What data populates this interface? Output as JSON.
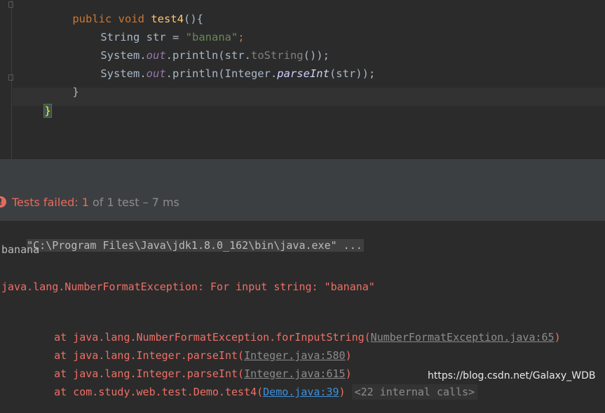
{
  "editor": {
    "line1": {
      "kw": "public void",
      "name": "test4",
      "rest": "(){"
    },
    "line2": {
      "type": "String str = ",
      "literal": "\"banana\"",
      "semi": ";"
    },
    "line3": {
      "a": "System.",
      "field": "out",
      "b": ".println(str.",
      "method": "toString",
      "c": "());"
    },
    "line4": {
      "a": "System.",
      "field": "out",
      "b": ".println(Integer.",
      "method": "parseInt",
      "c": "(str));"
    },
    "line5": "}",
    "line6": "}"
  },
  "status": {
    "icon": "error-icon",
    "failed_label": "Tests failed: 1",
    "summary": " of 1 test – 7 ms"
  },
  "console": {
    "command": "\"C:\\Program Files\\Java\\jdk1.8.0_162\\bin\\java.exe\" ...",
    "stdout": "banana",
    "exception": "java.lang.NumberFormatException: For input string: \"banana\"",
    "frames": [
      {
        "prefix": "at java.lang.NumberFormatException.forInputString(",
        "link": "NumberFormatException.java:65",
        "suffix": ")"
      },
      {
        "prefix": "at java.lang.Integer.parseInt(",
        "link": "Integer.java:580",
        "suffix": ")"
      },
      {
        "prefix": "at java.lang.Integer.parseInt(",
        "link": "Integer.java:615",
        "suffix": ")"
      },
      {
        "prefix": "at com.study.web.test.Demo.test4(",
        "link": "Demo.java:39",
        "suffix": ")"
      }
    ],
    "internal_calls": "<22 internal calls>"
  },
  "watermark": "https://blog.csdn.net/Galaxy_WDB",
  "colors": {
    "background": "#2b2b2b",
    "keyword": "#cc7832",
    "function": "#ffc66d",
    "string": "#6a8759",
    "error": "#e8695d",
    "link": "#3d8fd8"
  }
}
